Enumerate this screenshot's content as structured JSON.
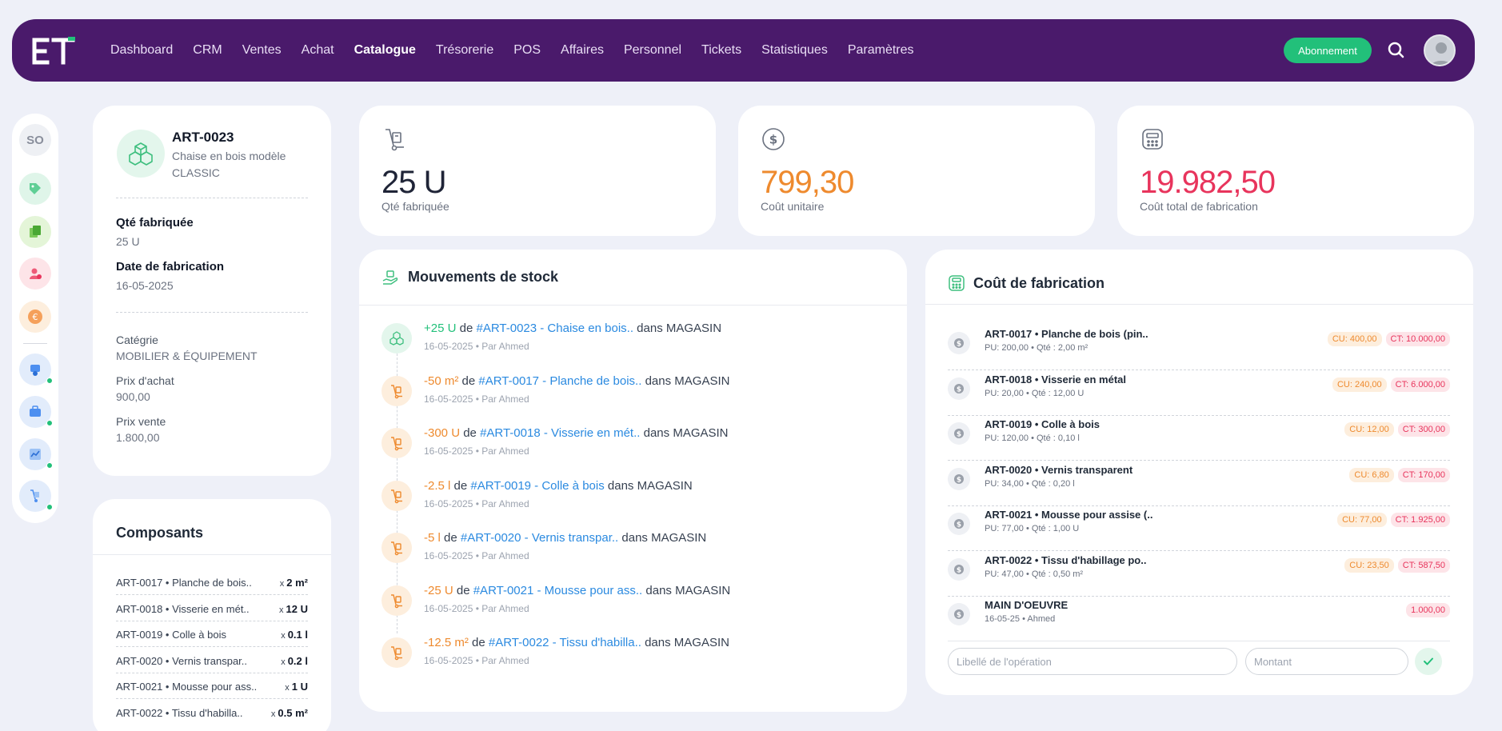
{
  "nav": {
    "items": [
      "Dashboard",
      "CRM",
      "Ventes",
      "Achat",
      "Catalogue",
      "Trésorerie",
      "POS",
      "Affaires",
      "Personnel",
      "Tickets",
      "Statistiques",
      "Paramètres"
    ],
    "active": "Catalogue",
    "subscribe_label": "Abonnement"
  },
  "rail": {
    "initials": "SO"
  },
  "article": {
    "code": "ART-0023",
    "name": "Chaise en bois modèle CLASSIC",
    "qty_label": "Qté fabriquée",
    "qty_value": "25 U",
    "date_label": "Date de fabrication",
    "date_value": "16-05-2025",
    "category_label": "Catégrie",
    "category_value": "MOBILIER & ÉQUIPEMENT",
    "buy_label": "Prix d'achat",
    "buy_value": "900,00",
    "sell_label": "Prix vente",
    "sell_value": "1.800,00"
  },
  "kpis": [
    {
      "value": "25 U",
      "label": "Qté fabriquée",
      "color": "#1f2437",
      "icon": "hand-truck-icon"
    },
    {
      "value": "799,30",
      "label": "Coût unitaire",
      "color": "#ee8a2e",
      "icon": "dollar-circle-icon"
    },
    {
      "value": "19.982,50",
      "label": "Coût total de fabrication",
      "color": "#e8345c",
      "icon": "calculator-icon"
    }
  ],
  "movements": {
    "title": "Mouvements de stock",
    "items": [
      {
        "qty": "+25 U",
        "of": "de",
        "ref": "#ART-0023 - Chaise en bois..",
        "loc": "dans MAGASIN",
        "meta": "16-05-2025 • Par Ahmed",
        "positive": true
      },
      {
        "qty": "-50 m²",
        "of": "de",
        "ref": "#ART-0017 - Planche de bois..",
        "loc": "dans MAGASIN",
        "meta": "16-05-2025 • Par Ahmed",
        "positive": false
      },
      {
        "qty": "-300 U",
        "of": "de",
        "ref": "#ART-0018 - Visserie en mét..",
        "loc": "dans MAGASIN",
        "meta": "16-05-2025 • Par Ahmed",
        "positive": false
      },
      {
        "qty": "-2.5 l",
        "of": "de",
        "ref": "#ART-0019 - Colle à bois",
        "loc": "dans MAGASIN",
        "meta": "16-05-2025 • Par Ahmed",
        "positive": false
      },
      {
        "qty": "-5 l",
        "of": "de",
        "ref": "#ART-0020 - Vernis transpar..",
        "loc": "dans MAGASIN",
        "meta": "16-05-2025 • Par Ahmed",
        "positive": false
      },
      {
        "qty": "-25 U",
        "of": "de",
        "ref": "#ART-0021 - Mousse pour ass..",
        "loc": "dans MAGASIN",
        "meta": "16-05-2025 • Par Ahmed",
        "positive": false
      },
      {
        "qty": "-12.5 m²",
        "of": "de",
        "ref": "#ART-0022 - Tissu d'habilla..",
        "loc": "dans MAGASIN",
        "meta": "16-05-2025 • Par Ahmed",
        "positive": false
      }
    ]
  },
  "costs": {
    "title": "Coût de fabrication",
    "items": [
      {
        "name": "ART-0017 • Planche de bois (pin..",
        "sub": "PU: 200,00 • Qté : 2,00 m²",
        "cu": "CU: 400,00",
        "ct": "CT: 10.000,00"
      },
      {
        "name": "ART-0018 • Visserie en métal",
        "sub": "PU: 20,00 • Qté : 12,00 U",
        "cu": "CU: 240,00",
        "ct": "CT: 6.000,00"
      },
      {
        "name": "ART-0019 • Colle à bois",
        "sub": "PU: 120,00 • Qté : 0,10 l",
        "cu": "CU: 12,00",
        "ct": "CT: 300,00"
      },
      {
        "name": "ART-0020 • Vernis transparent",
        "sub": "PU: 34,00 • Qté : 0,20 l",
        "cu": "CU: 6,80",
        "ct": "CT: 170,00"
      },
      {
        "name": "ART-0021 • Mousse pour assise (..",
        "sub": "PU: 77,00 • Qté : 1,00 U",
        "cu": "CU: 77,00",
        "ct": "CT: 1.925,00"
      },
      {
        "name": "ART-0022 • Tissu d'habillage po..",
        "sub": "PU: 47,00 • Qté : 0,50 m²",
        "cu": "CU: 23,50",
        "ct": "CT: 587,50"
      },
      {
        "name": "MAIN D'OEUVRE",
        "sub": "16-05-25 • Ahmed",
        "cu": "",
        "ct": "1.000,00"
      }
    ],
    "label_placeholder": "Libellé de l'opération",
    "amount_placeholder": "Montant"
  },
  "components": {
    "title": "Composants",
    "items": [
      {
        "name": "ART-0017 • Planche de bois..",
        "x": "x",
        "qty": "2 m²"
      },
      {
        "name": "ART-0018 • Visserie en mét..",
        "x": "x",
        "qty": "12 U"
      },
      {
        "name": "ART-0019 • Colle à bois",
        "x": "x",
        "qty": "0.1 l"
      },
      {
        "name": "ART-0020 • Vernis transpar..",
        "x": "x",
        "qty": "0.2 l"
      },
      {
        "name": "ART-0021 • Mousse pour ass..",
        "x": "x",
        "qty": "1 U"
      },
      {
        "name": "ART-0022 • Tissu d'habilla..",
        "x": "x",
        "qty": "0.5 m²"
      }
    ]
  }
}
